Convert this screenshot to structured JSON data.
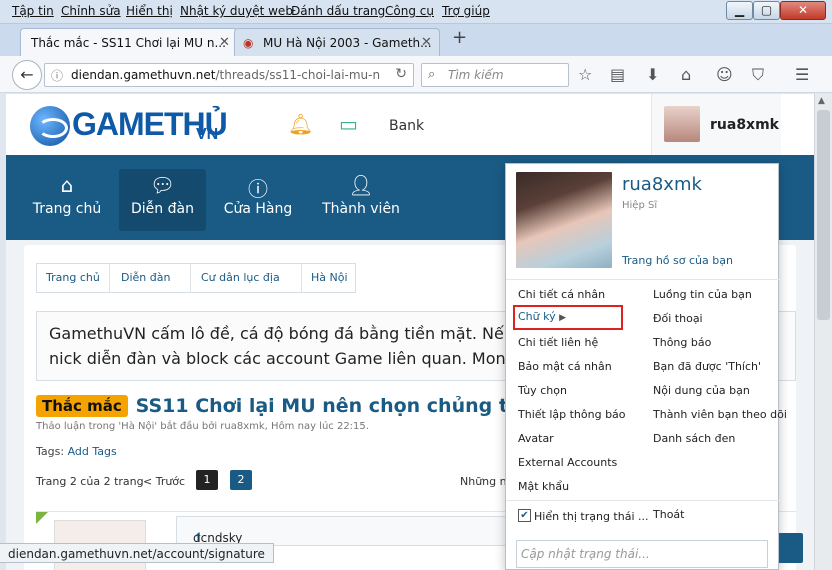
{
  "menubar": {
    "items": [
      "Tập tin",
      "Chỉnh sửa",
      "Hiển thị",
      "Nhật ký duyệt web",
      "Đánh dấu trang",
      "Công cụ",
      "Trợ giúp"
    ]
  },
  "tabs": [
    {
      "title": "Thắc mắc - SS11 Chơi lại MU n...",
      "active": true
    },
    {
      "title": "MU Hà Nội 2003 - Gameth...",
      "active": false
    }
  ],
  "navbar": {
    "url_domain": "diendan.gamethuvn.net",
    "url_path": "/threads/ss11-choi-lai-mu-n",
    "search_placeholder": "Tìm kiếm"
  },
  "site": {
    "logo_text": "GAMETHỦ",
    "logo_suffix": "VN",
    "bank_label": "Bank",
    "username": "rua8xmk"
  },
  "main_nav": [
    {
      "label": "Trang chủ",
      "icon": "home-icon"
    },
    {
      "label": "Diễn đàn",
      "icon": "chat-icon",
      "selected": true
    },
    {
      "label": "Cửa Hàng",
      "icon": "question-circle-icon"
    },
    {
      "label": "Thành viên",
      "icon": "user-icon"
    }
  ],
  "breadcrumb": [
    "Trang chủ",
    "Diễn đàn",
    "Cư dân lục địa",
    "Hà Nội"
  ],
  "notice": {
    "line1": "GamethuVN cấm lô đề, cá độ bóng đá bằng tiền mặt. Nếu p",
    "line2": "nick diễn đàn và block các account Game liên quan. Mong c"
  },
  "thread": {
    "prefix": "Thắc mắc",
    "title": "SS11 Chơi lại MU nên chọn chủng tộc n",
    "meta": "Thảo luận trong 'Hà Nội' bắt đầu bởi rua8xmk, Hôm nay lúc 22:15.",
    "tags_label": "Tags:",
    "tags_link": "Add Tags"
  },
  "pager": {
    "info": "Trang 2 của 2 trang",
    "prev": "< Trước",
    "pages": [
      "1",
      "2"
    ],
    "current": "2",
    "right_text": "Những ng"
  },
  "post": {
    "quote_author": "dcndsky said:",
    "quote_arrow": "↑"
  },
  "status_url": "diendan.gamethuvn.net/account/signature",
  "dropdown": {
    "name": "rua8xmk",
    "rank": "Hiệp Sĩ",
    "profile_link": "Trang hồ sơ của bạn",
    "left_items": [
      "Chi tiết cá nhân",
      "Chữ ký",
      "Chi tiết liên hệ",
      "Bảo mật cá nhân",
      "Tùy chọn",
      "Thiết lập thông báo",
      "Avatar",
      "External Accounts",
      "Mật khẩu"
    ],
    "right_items": [
      "Luồng tin của bạn",
      "Đối thoại",
      "Thông báo",
      "Bạn đã được 'Thích'",
      "Nội dung của bạn",
      "Thành viên bạn theo dõi",
      "Danh sách đen"
    ],
    "show_status_label": "Hiển thị trạng thái ...",
    "show_status_checked": true,
    "logout": "Thoát",
    "status_placeholder": "Cập nhật trạng thái..."
  },
  "colors": {
    "nav_bg": "#1a5b85",
    "link": "#1a5b85",
    "prefix_bg": "#f5a300",
    "highlight_border": "#dd2222"
  }
}
